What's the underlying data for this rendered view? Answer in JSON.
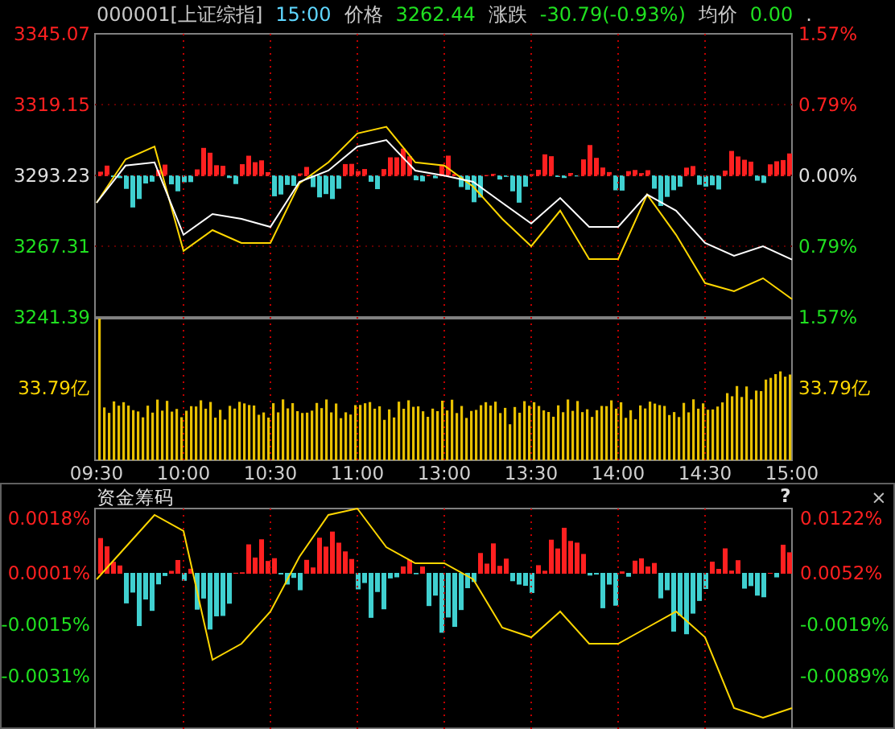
{
  "header": {
    "code": "000001[上证综指]",
    "time": "15:00",
    "price_label": "价格",
    "price": "3262.44",
    "change_label": "涨跌",
    "change": "-30.79(-0.93%)",
    "avg_label": "均价",
    "avg": "0.00",
    "dot": "."
  },
  "price_panel": {
    "left_labels": [
      {
        "color": "#ff2020"
      },
      {
        "color": "#ff2020"
      },
      {
        "color": "#e0e0e0"
      },
      {
        "color": "#20e020"
      },
      {
        "color": "#20e020"
      }
    ],
    "right_labels": [
      {
        "text": "1.57%",
        "color": "#ff2020"
      },
      {
        "text": "0.79%",
        "color": "#ff2020"
      },
      {
        "text": "0.00%",
        "color": "#e0e0e0"
      },
      {
        "text": "0.79%",
        "color": "#20e020"
      },
      {
        "text": "1.57%",
        "color": "#20e020"
      }
    ],
    "volume_left": "33.79亿",
    "volume_right": "33.79亿",
    "time_axis": [
      "09:30",
      "10:00",
      "10:30",
      "11:00",
      "13:00",
      "13:30",
      "14:00",
      "14:30",
      "15:00"
    ],
    "chart_data": {
      "type": "line",
      "grid": true,
      "categories": [
        null,
        null,
        null,
        null,
        null,
        null,
        null,
        null,
        null,
        null,
        null,
        null,
        null,
        null,
        null,
        null,
        null,
        null,
        null,
        null,
        null,
        null,
        null,
        null,
        null
      ],
      "ylim": [
        3241.39,
        3345.07
      ],
      "yticks": [
        {
          "value": 3345.07,
          "label": "3345.07"
        },
        {
          "value": 3319.15,
          "label": "3319.15"
        },
        {
          "value": 3293.23,
          "label": "3293.23"
        },
        {
          "value": 3267.31,
          "label": "3267.31"
        },
        {
          "value": 3241.39,
          "label": "3241.39"
        }
      ],
      "series": [
        {
          "color": "#ffffff",
          "values": [
            3283.2,
            3296.8,
            3298.0,
            3271.5,
            3279.1,
            3277.3,
            3274.4,
            3290.9,
            3295.0,
            3303.8,
            3306.2,
            3295.0,
            3293.2,
            3290.9,
            3283.2,
            3275.6,
            3285.0,
            3274.4,
            3274.4,
            3286.2,
            3280.3,
            3268.5,
            3263.8,
            3267.3,
            3262.4
          ]
        },
        {
          "color": "#ffd700",
          "values": [
            3283.2,
            3299.1,
            3303.8,
            3265.6,
            3273.2,
            3268.5,
            3268.5,
            3290.3,
            3298.0,
            3308.6,
            3311.0,
            3298.0,
            3296.8,
            3289.1,
            3277.3,
            3267.3,
            3280.3,
            3262.6,
            3262.6,
            3286.2,
            3271.5,
            3253.8,
            3250.8,
            3255.6,
            3247.9
          ]
        }
      ]
    }
  },
  "fund_panel": {
    "title": "资金筹码",
    "help": "?",
    "close": "×",
    "left_labels": [
      {
        "color": "#ff2020"
      },
      {
        "color": "#ff2020"
      },
      {
        "color": "#20e020"
      },
      {
        "color": "#20e020"
      }
    ],
    "right_labels": [
      {
        "text": "0.0122%",
        "color": "#ff2020"
      },
      {
        "text": "0.0052%",
        "color": "#ff2020"
      },
      {
        "text": "-0.0019%",
        "color": "#20e020"
      },
      {
        "text": "-0.0089%",
        "color": "#20e020"
      }
    ],
    "chart_data": {
      "type": "line",
      "grid": true,
      "categories": [
        null,
        null,
        null,
        null,
        null,
        null,
        null,
        null,
        null,
        null,
        null,
        null,
        null,
        null,
        null,
        null,
        null,
        null,
        null,
        null,
        null,
        null,
        null,
        null,
        null
      ],
      "ylim": [
        -0.00475,
        0.0021
      ],
      "yticks": [
        {
          "value": 0.0018,
          "label": "0.0018%"
        },
        {
          "value": 0.0001,
          "label": "0.0001%"
        },
        {
          "value": -0.0015,
          "label": "-0.0015%"
        },
        {
          "value": -0.0031,
          "label": "-0.0031%"
        }
      ],
      "series": [
        {
          "color": "#ffd700",
          "values": [
            -0.0001,
            0.0009,
            0.0019,
            0.0014,
            -0.0026,
            -0.0021,
            -0.0011,
            0.0006,
            0.0019,
            0.0021,
            0.0009,
            0.0004,
            0.0004,
            -0.0001,
            -0.0016,
            -0.0019,
            -0.0011,
            -0.0021,
            -0.0021,
            -0.0016,
            -0.0011,
            -0.0019,
            -0.0041,
            -0.0044,
            -0.0041
          ]
        }
      ]
    }
  }
}
